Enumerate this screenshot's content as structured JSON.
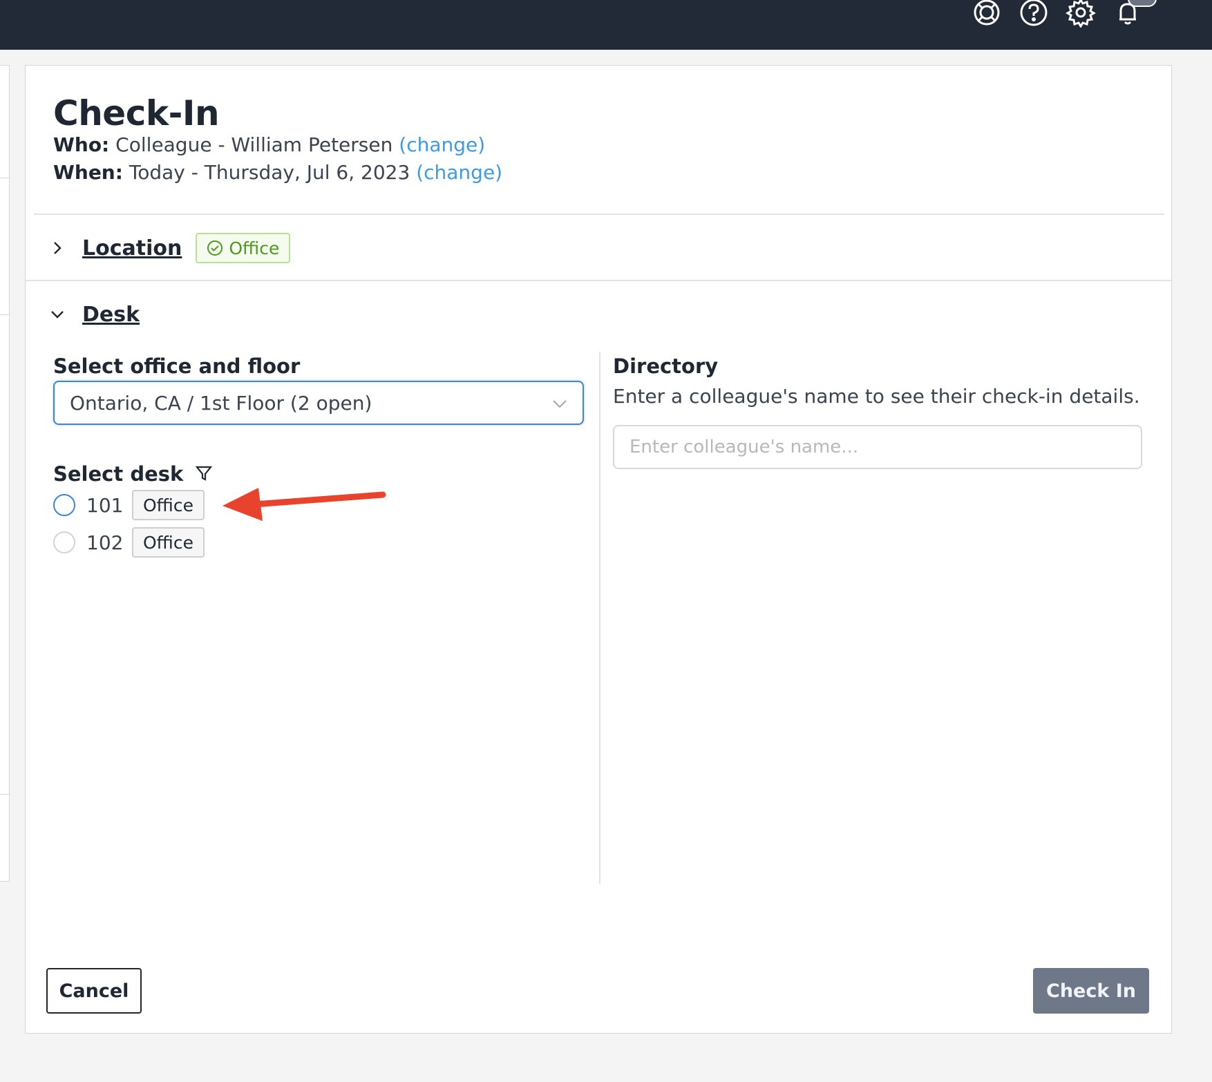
{
  "header": {
    "icons": [
      "lifebuoy-icon",
      "help-icon",
      "gear-icon",
      "bell-icon"
    ]
  },
  "checkin": {
    "title": "Check-In",
    "who_label": "Who:",
    "who_value": "Colleague - William Petersen",
    "who_change": "(change)",
    "when_label": "When:",
    "when_value": "Today - Thursday, Jul 6, 2023",
    "when_change": "(change)"
  },
  "location": {
    "title": "Location",
    "expanded": false,
    "badge": "Office"
  },
  "desk": {
    "title": "Desk",
    "expanded": true,
    "office_floor_label": "Select office and floor",
    "office_floor_value": "Ontario, CA / 1st Floor (2 open)",
    "select_desk_label": "Select desk",
    "desks": [
      {
        "number": "101",
        "tag": "Office",
        "selected": false
      },
      {
        "number": "102",
        "tag": "Office",
        "selected": false
      }
    ]
  },
  "directory": {
    "title": "Directory",
    "description": "Enter a colleague's name to see their check-in details.",
    "placeholder": "Enter colleague's name..."
  },
  "footer": {
    "cancel_label": "Cancel",
    "checkin_label": "Check In"
  },
  "colors": {
    "topbar": "#212a36",
    "link": "#3b9be8",
    "success": "#4c9a1f",
    "accent": "#3b82e4",
    "annotation_arrow": "#e8432d",
    "primary_disabled": "#6f7888"
  }
}
